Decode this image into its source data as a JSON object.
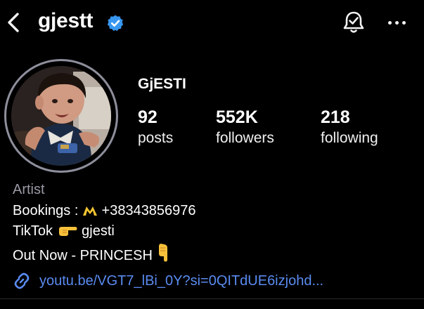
{
  "header": {
    "username": "gjestt",
    "verified": true,
    "icons": [
      "back-arrow-icon",
      "verified-badge-icon",
      "notification-bell-icon",
      "more-options-icon"
    ]
  },
  "profile": {
    "display_name": "GjESTI",
    "stats": [
      {
        "value": "92",
        "label": "posts"
      },
      {
        "value": "552K",
        "label": "followers"
      },
      {
        "value": "218",
        "label": "following"
      }
    ]
  },
  "bio": {
    "category": "Artist",
    "bookings_prefix": "Bookings : ",
    "bookings_phone": "+38343856976",
    "tiktok_prefix": "TikTok",
    "tiktok_handle": "gjesti",
    "release": "Out Now - PRINCESH"
  },
  "link": {
    "text": "youtu.be/VGT7_lBi_0Y?si=0QITdUE6izjohd..."
  },
  "colors": {
    "background": "#000000",
    "text": "#ffffff",
    "category": "#9a9aa5",
    "link": "#5a8bf0",
    "verified": "#3897f0",
    "avatar_ring": "#8e8f9c"
  }
}
